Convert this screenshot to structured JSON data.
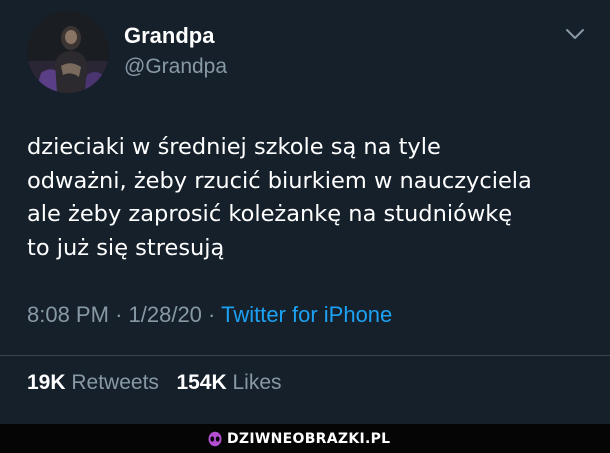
{
  "tweet": {
    "display_name": "Grandpa",
    "handle": "@Grandpa",
    "text_lines": [
      "dzieciaki w średniej szkole są na tyle",
      "odważni, żeby rzucić biurkiem w nauczyciela",
      "ale żeby zaprosić koleżankę na studniówkę",
      "to już się stresują"
    ],
    "time": "8:08 PM",
    "date": "1/28/20",
    "separator": "·",
    "source": "Twitter for iPhone"
  },
  "stats": {
    "retweets_count": "19K",
    "retweets_label": "Retweets",
    "likes_count": "154K",
    "likes_label": "Likes"
  },
  "icons": {
    "avatar": "profile-photo",
    "menu": "chevron-down-icon",
    "watermark": "alien-head-icon"
  },
  "watermark": {
    "text": "DZIWNEOBRAZKI.PL"
  },
  "colors": {
    "background": "#15202b",
    "text_primary": "#ffffff",
    "text_secondary": "#8899a6",
    "link": "#1da1f2",
    "divider": "#38444d",
    "watermark_accent": "#b34fd1"
  }
}
